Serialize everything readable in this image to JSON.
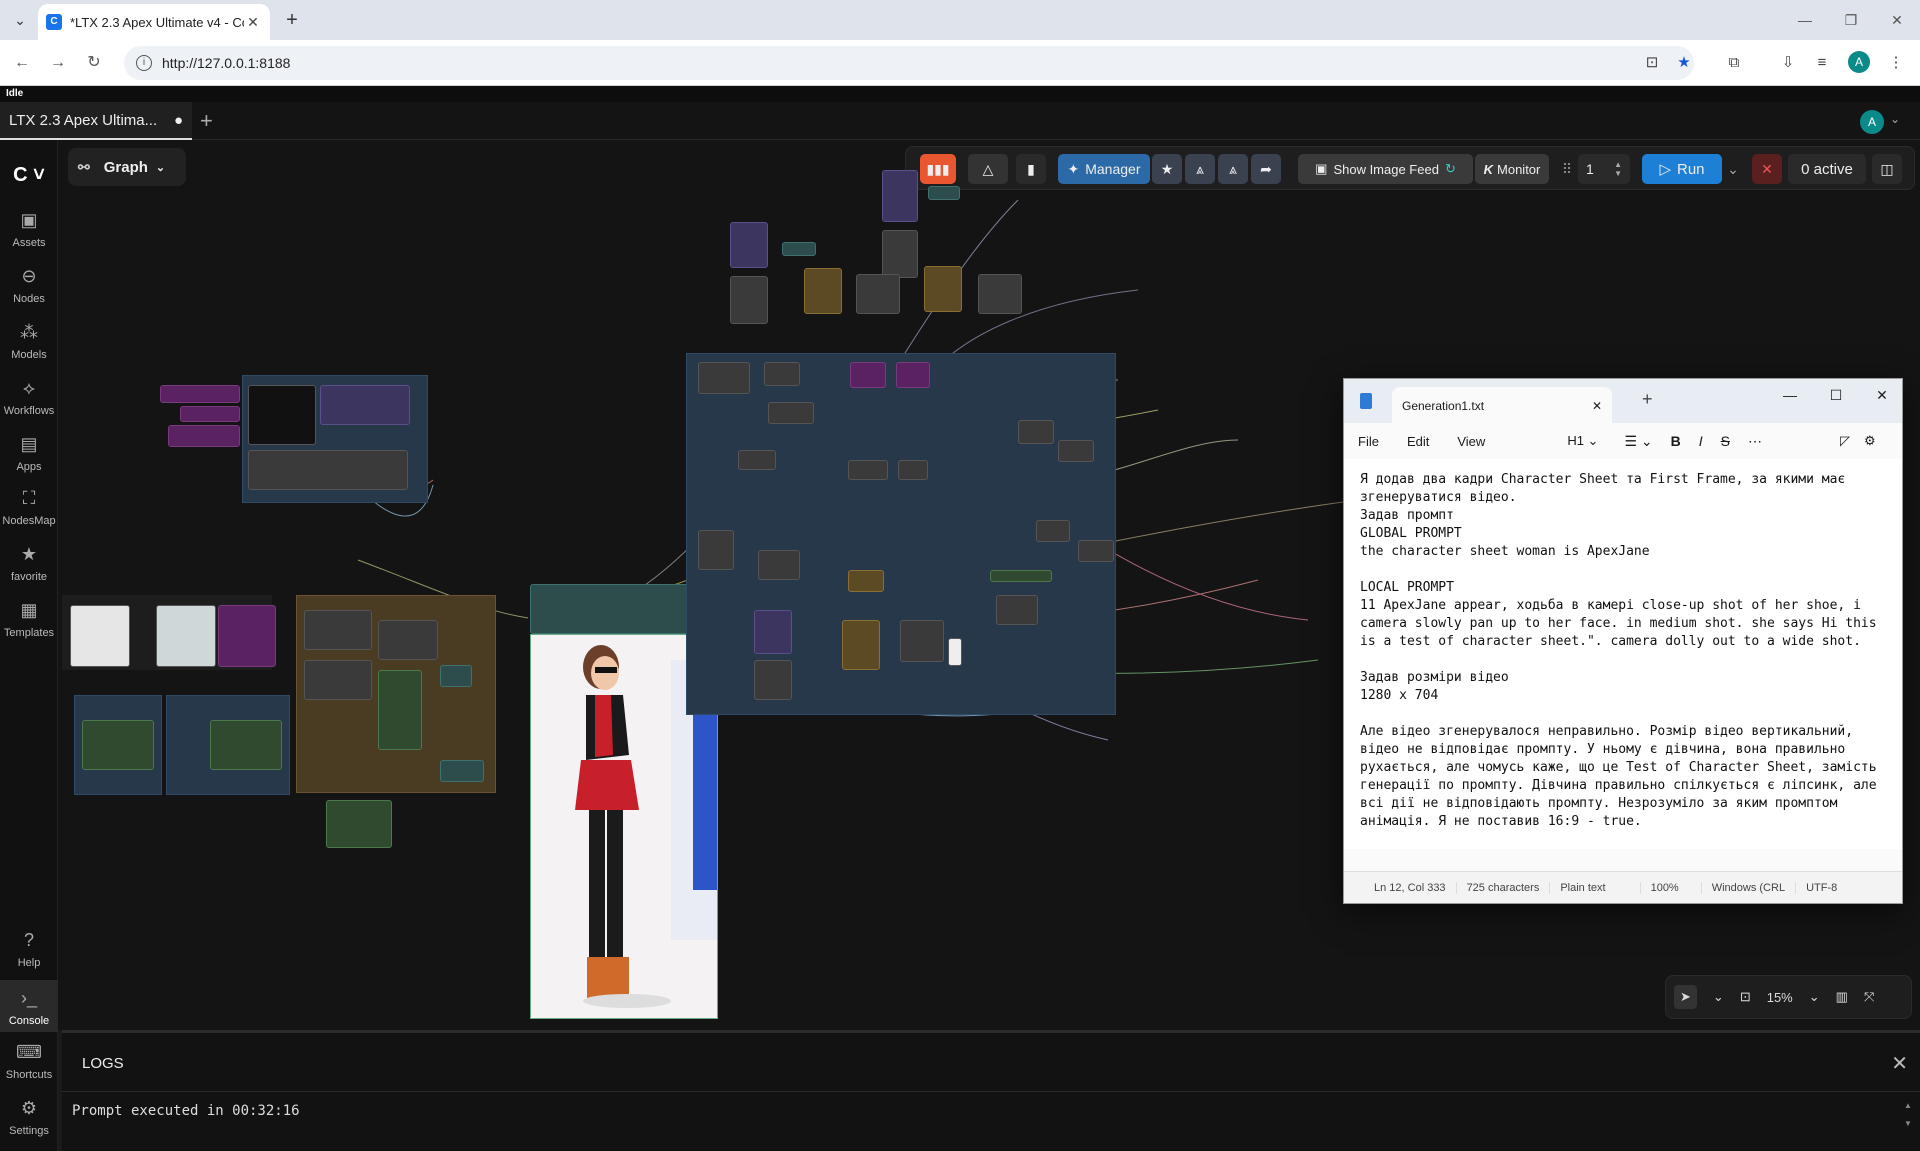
{
  "browser": {
    "tab_title": "*LTX 2.3 Apex Ultimate v4 - Cor",
    "url": "http://127.0.0.1:8188"
  },
  "app": {
    "status": "Idle",
    "workflow_tab": "LTX 2.3 Apex Ultima...",
    "avatar": "A",
    "graph_mode": "Graph"
  },
  "sidebar": {
    "items": [
      {
        "label": "Assets",
        "icon": "assets-icon"
      },
      {
        "label": "Nodes",
        "icon": "nodes-icon"
      },
      {
        "label": "Models",
        "icon": "models-icon"
      },
      {
        "label": "Workflows",
        "icon": "workflows-icon"
      },
      {
        "label": "Apps",
        "icon": "apps-icon"
      },
      {
        "label": "NodesMap",
        "icon": "nodesmap-icon"
      },
      {
        "label": "favorite",
        "icon": "star-icon"
      },
      {
        "label": "Templates",
        "icon": "templates-icon"
      }
    ],
    "bottom": [
      {
        "label": "Help",
        "icon": "help-icon"
      },
      {
        "label": "Console",
        "icon": "console-icon"
      },
      {
        "label": "Shortcuts",
        "icon": "keyboard-icon"
      },
      {
        "label": "Settings",
        "icon": "gear-icon"
      }
    ]
  },
  "toolbar": {
    "manager": "Manager",
    "show_image_feed": "Show Image Feed",
    "monitor": "Monitor",
    "batch_count": "1",
    "run": "Run",
    "active": "0 active"
  },
  "zoom": {
    "level": "15%"
  },
  "logs": {
    "header": "LOGS",
    "line": "Prompt executed in 00:32:16"
  },
  "notepad": {
    "file": "Generation1.txt",
    "menu": [
      "File",
      "Edit",
      "View"
    ],
    "heading": "H1",
    "content": "Я додав два кадри Character Sheet та First Frame, за якими має\nзгенеруватися відео.\nЗадав промпт\nGLOBAL PROMPT\nthe character sheet woman is ApexJane\n\nLOCAL PROMPT\n11 ApexJane appear, ходьба в камері close-up shot of her shoe, i\ncamera slowly pan up to her face. in medium shot. she says Hi this\nis a test of character sheet.\". camera dolly out to a wide shot.\n\nЗадав розміри відео\n1280 x 704\n\nАле відео згенерувалося неправильно. Розмір відео вертикальний,\nвідео не відповідає промпту. У ньому є дівчина, вона правильно\nрухається, але чомусь каже, що це Test of Character Sheet, замість\nгенерації по промпту. Дівчина правильно спілкується є ліпсинк, але\nвсі дії не відповідають промпту. Незрозуміло за яким промптом\nанімація. Я не поставив 16:9 - true.",
    "status": {
      "position": "Ln 12, Col 333",
      "chars": "725 characters",
      "type": "Plain text",
      "zoom": "100%",
      "eol": "Windows (CRL",
      "encoding": "UTF-8"
    }
  }
}
